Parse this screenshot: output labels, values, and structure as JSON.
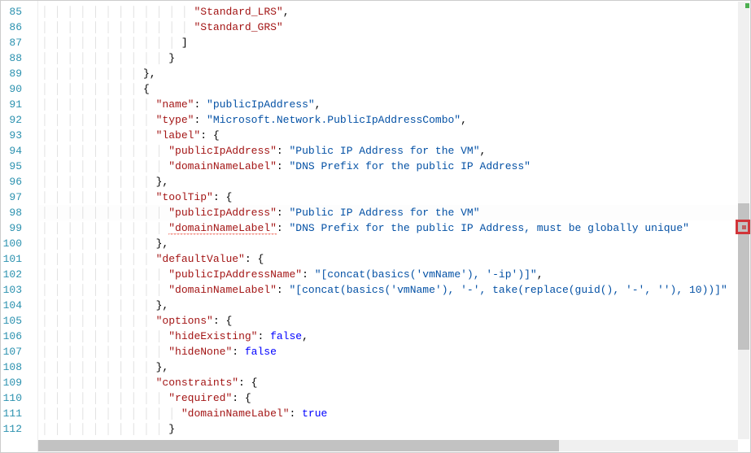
{
  "lineStart": 85,
  "lineEnd": 112,
  "errorLine": 99,
  "errorKey": "domainNameLabel",
  "lines": [
    {
      "n": 85,
      "indent": 12,
      "tokens": [
        [
          "k",
          "\"Standard_LRS\""
        ],
        [
          "p",
          ","
        ]
      ]
    },
    {
      "n": 86,
      "indent": 12,
      "tokens": [
        [
          "k",
          "\"Standard_GRS\""
        ]
      ]
    },
    {
      "n": 87,
      "indent": 11,
      "tokens": [
        [
          "p",
          "]"
        ]
      ]
    },
    {
      "n": 88,
      "indent": 10,
      "tokens": [
        [
          "p",
          "}"
        ]
      ]
    },
    {
      "n": 89,
      "indent": 8,
      "tokens": [
        [
          "p",
          "},"
        ]
      ]
    },
    {
      "n": 90,
      "indent": 8,
      "tokens": [
        [
          "p",
          "{"
        ]
      ]
    },
    {
      "n": 91,
      "indent": 9,
      "tokens": [
        [
          "k",
          "\"name\""
        ],
        [
          "p",
          ": "
        ],
        [
          "s",
          "\"publicIpAddress\""
        ],
        [
          "p",
          ","
        ]
      ]
    },
    {
      "n": 92,
      "indent": 9,
      "tokens": [
        [
          "k",
          "\"type\""
        ],
        [
          "p",
          ": "
        ],
        [
          "s",
          "\"Microsoft.Network.PublicIpAddressCombo\""
        ],
        [
          "p",
          ","
        ]
      ]
    },
    {
      "n": 93,
      "indent": 9,
      "tokens": [
        [
          "k",
          "\"label\""
        ],
        [
          "p",
          ": {"
        ]
      ]
    },
    {
      "n": 94,
      "indent": 10,
      "tokens": [
        [
          "k",
          "\"publicIpAddress\""
        ],
        [
          "p",
          ": "
        ],
        [
          "s",
          "\"Public IP Address for the VM\""
        ],
        [
          "p",
          ","
        ]
      ]
    },
    {
      "n": 95,
      "indent": 10,
      "tokens": [
        [
          "k",
          "\"domainNameLabel\""
        ],
        [
          "p",
          ": "
        ],
        [
          "s",
          "\"DNS Prefix for the public IP Address\""
        ]
      ]
    },
    {
      "n": 96,
      "indent": 9,
      "tokens": [
        [
          "p",
          "},"
        ]
      ]
    },
    {
      "n": 97,
      "indent": 9,
      "tokens": [
        [
          "k",
          "\"toolTip\""
        ],
        [
          "p",
          ": {"
        ]
      ]
    },
    {
      "n": 98,
      "indent": 10,
      "tokens": [
        [
          "k",
          "\"publicIpAddress\""
        ],
        [
          "p",
          ": "
        ],
        [
          "s",
          "\"Public IP Address for the VM\""
        ]
      ],
      "hl": true
    },
    {
      "n": 99,
      "indent": 10,
      "tokens": [
        [
          "err",
          "\"domainNameLabel\""
        ],
        [
          "p",
          ": "
        ],
        [
          "s",
          "\"DNS Prefix for the public IP Address, must be globally unique\""
        ]
      ]
    },
    {
      "n": 100,
      "indent": 9,
      "tokens": [
        [
          "p",
          "},"
        ]
      ]
    },
    {
      "n": 101,
      "indent": 9,
      "tokens": [
        [
          "k",
          "\"defaultValue\""
        ],
        [
          "p",
          ": {"
        ]
      ]
    },
    {
      "n": 102,
      "indent": 10,
      "tokens": [
        [
          "k",
          "\"publicIpAddressName\""
        ],
        [
          "p",
          ": "
        ],
        [
          "s",
          "\"[concat(basics('vmName'), '-ip')]\""
        ],
        [
          "p",
          ","
        ]
      ]
    },
    {
      "n": 103,
      "indent": 10,
      "tokens": [
        [
          "k",
          "\"domainNameLabel\""
        ],
        [
          "p",
          ": "
        ],
        [
          "s",
          "\"[concat(basics('vmName'), '-', take(replace(guid(), '-', ''), 10))]\""
        ]
      ]
    },
    {
      "n": 104,
      "indent": 9,
      "tokens": [
        [
          "p",
          "},"
        ]
      ]
    },
    {
      "n": 105,
      "indent": 9,
      "tokens": [
        [
          "k",
          "\"options\""
        ],
        [
          "p",
          ": {"
        ]
      ]
    },
    {
      "n": 106,
      "indent": 10,
      "tokens": [
        [
          "k",
          "\"hideExisting\""
        ],
        [
          "p",
          ": "
        ],
        [
          "kw",
          "false"
        ],
        [
          "p",
          ","
        ]
      ]
    },
    {
      "n": 107,
      "indent": 10,
      "tokens": [
        [
          "k",
          "\"hideNone\""
        ],
        [
          "p",
          ": "
        ],
        [
          "kw",
          "false"
        ]
      ]
    },
    {
      "n": 108,
      "indent": 9,
      "tokens": [
        [
          "p",
          "},"
        ]
      ]
    },
    {
      "n": 109,
      "indent": 9,
      "tokens": [
        [
          "k",
          "\"constraints\""
        ],
        [
          "p",
          ": {"
        ]
      ]
    },
    {
      "n": 110,
      "indent": 10,
      "tokens": [
        [
          "k",
          "\"required\""
        ],
        [
          "p",
          ": {"
        ]
      ]
    },
    {
      "n": 111,
      "indent": 11,
      "tokens": [
        [
          "k",
          "\"domainNameLabel\""
        ],
        [
          "p",
          ": "
        ],
        [
          "kw",
          "true"
        ]
      ]
    },
    {
      "n": 112,
      "indent": 10,
      "tokens": [
        [
          "p",
          "}"
        ]
      ]
    }
  ]
}
